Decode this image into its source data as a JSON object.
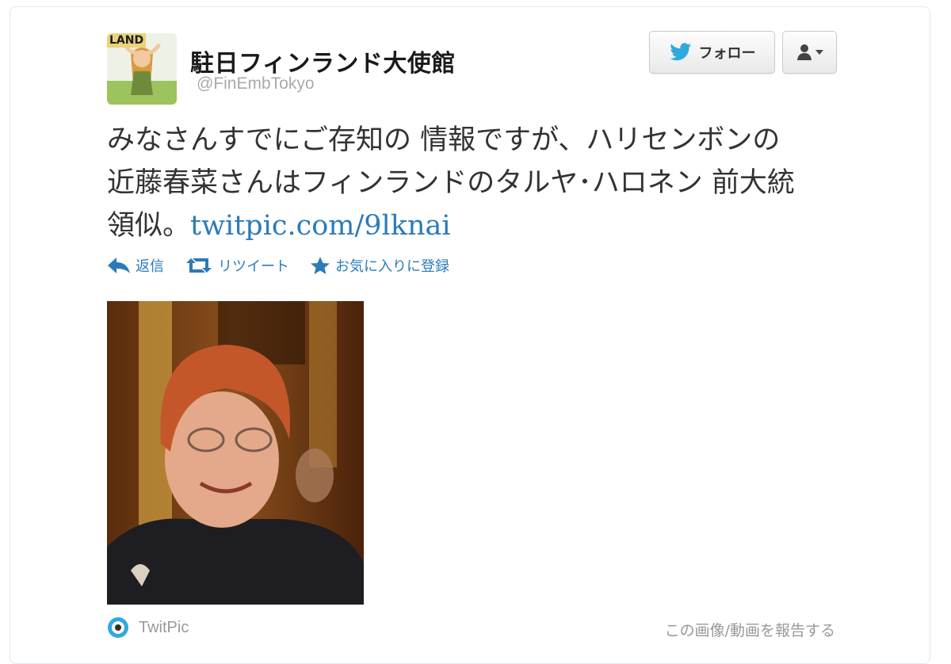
{
  "user": {
    "display_name": "駐日フィンランド大使館",
    "screen_name": "@FinEmbTokyo",
    "avatar_text": "LAND"
  },
  "buttons": {
    "follow_label": "フォロー"
  },
  "tweet": {
    "text_line1": "みなさんすでにご存知の 情報ですが、ハリセンボンの",
    "text_line2": "近藤春菜さんはフィンランドのタルヤ･ハロネン 前大統",
    "text_line3": "領似。",
    "link": "twitpic.com/9lknai"
  },
  "actions": {
    "reply": "返信",
    "retweet": "リツイート",
    "favorite": "お気に入りに登録"
  },
  "media": {
    "source": "TwitPic",
    "report": "この画像/動画を報告する"
  },
  "colors": {
    "link": "#2b7bb9",
    "twitter_bird": "#2fa9e0"
  },
  "icons": [
    "twitter-bird-icon",
    "user-icon",
    "chevron-down-icon",
    "reply-icon",
    "retweet-icon",
    "star-icon",
    "twitpic-icon"
  ]
}
